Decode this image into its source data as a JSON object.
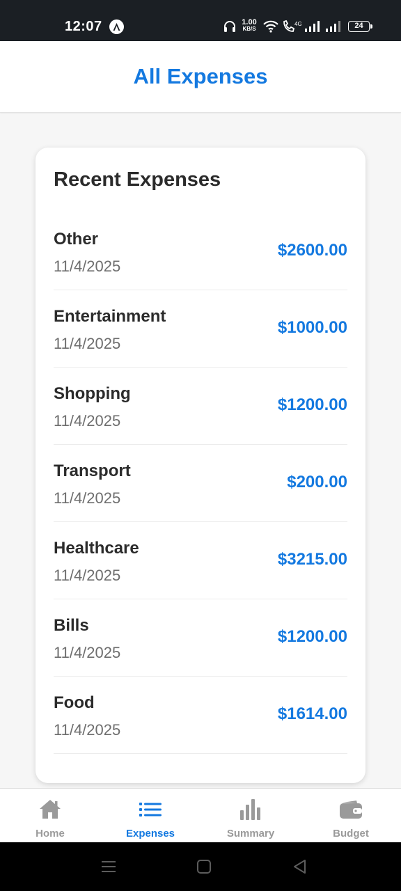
{
  "status_bar": {
    "time": "12:07",
    "net_speed_value": "1.00",
    "net_speed_unit": "KB/S",
    "battery": "24"
  },
  "header": {
    "title": "All Expenses"
  },
  "card": {
    "title": "Recent Expenses",
    "expenses": [
      {
        "category": "Other",
        "date": "11/4/2025",
        "amount": "$2600.00"
      },
      {
        "category": "Entertainment",
        "date": "11/4/2025",
        "amount": "$1000.00"
      },
      {
        "category": "Shopping",
        "date": "11/4/2025",
        "amount": "$1200.00"
      },
      {
        "category": "Transport",
        "date": "11/4/2025",
        "amount": "$200.00"
      },
      {
        "category": "Healthcare",
        "date": "11/4/2025",
        "amount": "$3215.00"
      },
      {
        "category": "Bills",
        "date": "11/4/2025",
        "amount": "$1200.00"
      },
      {
        "category": "Food",
        "date": "11/4/2025",
        "amount": "$1614.00"
      }
    ]
  },
  "bottom_nav": {
    "items": [
      {
        "label": "Home",
        "icon": "home-icon",
        "active": false
      },
      {
        "label": "Expenses",
        "icon": "list-icon",
        "active": true
      },
      {
        "label": "Summary",
        "icon": "bar-chart-icon",
        "active": false
      },
      {
        "label": "Budget",
        "icon": "wallet-icon",
        "active": false
      }
    ]
  },
  "colors": {
    "accent": "#1479e0",
    "inactive": "#9a9a9a",
    "status_bar_bg": "#1b1f24"
  }
}
